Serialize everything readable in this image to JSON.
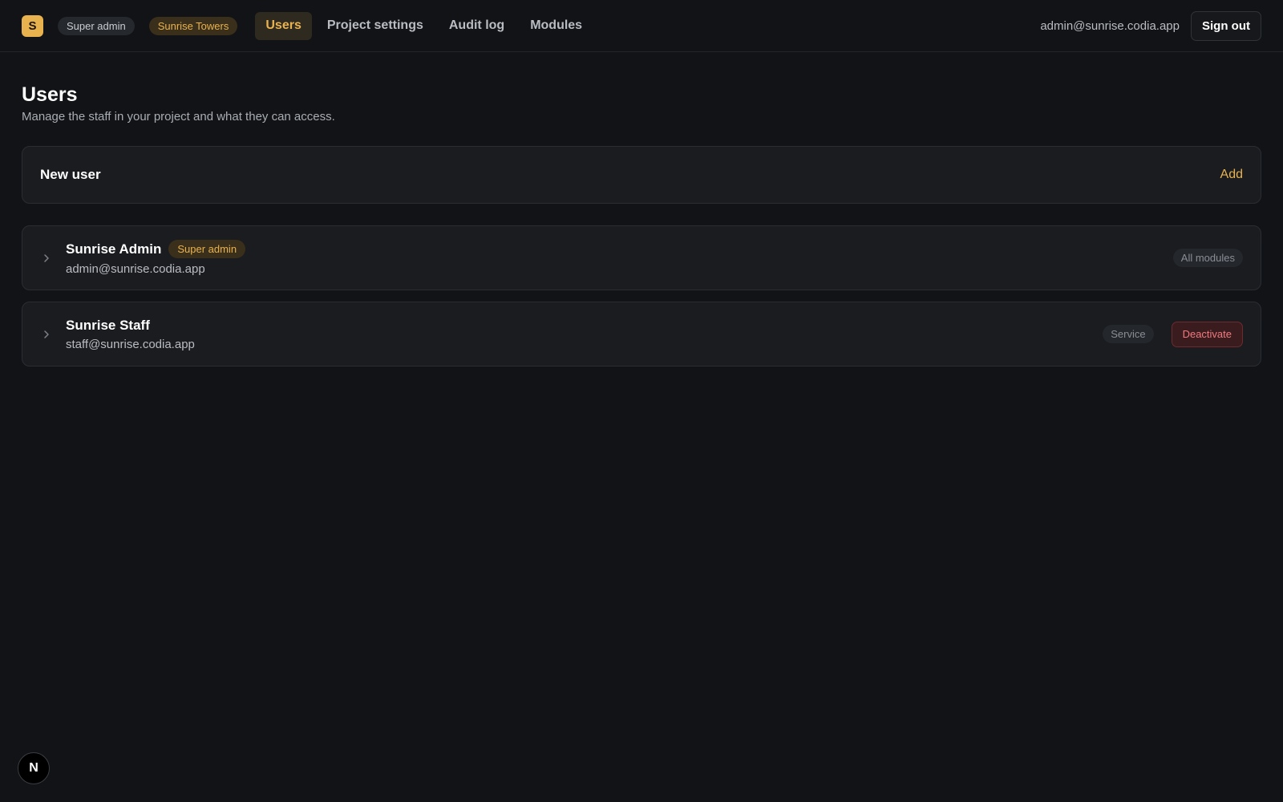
{
  "header": {
    "logo_letter": "S",
    "role_pill": "Super admin",
    "project_pill": "Sunrise Towers",
    "nav": [
      {
        "label": "Users",
        "active": true
      },
      {
        "label": "Project settings",
        "active": false
      },
      {
        "label": "Audit log",
        "active": false
      },
      {
        "label": "Modules",
        "active": false
      }
    ],
    "user_email": "admin@sunrise.codia.app",
    "sign_out_label": "Sign out"
  },
  "page": {
    "title": "Users",
    "subtitle": "Manage the staff in your project and what they can access."
  },
  "new_user": {
    "title": "New user",
    "add_label": "Add"
  },
  "users": [
    {
      "name": "Sunrise Admin",
      "role_badge": "Super admin",
      "email": "admin@sunrise.codia.app",
      "modules": "All modules"
    },
    {
      "name": "Sunrise Staff",
      "email": "staff@sunrise.codia.app",
      "modules": "Service",
      "action_label": "Deactivate"
    }
  ],
  "dev_badge": "N",
  "colors": {
    "accent": "#e8b24f",
    "background": "#111316",
    "card": "#1a1c20",
    "danger": "#f07a7f"
  },
  "icons": {
    "expand": "chevron-right-icon"
  }
}
